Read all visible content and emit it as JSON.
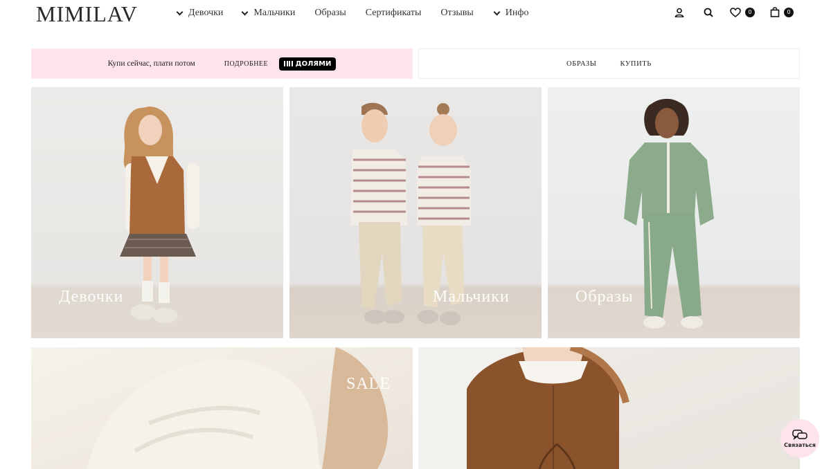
{
  "header": {
    "logo": "MIMILAV",
    "nav": [
      {
        "label": "Девочки",
        "dropdown": true
      },
      {
        "label": "Мальчики",
        "dropdown": true
      },
      {
        "label": "Образы",
        "dropdown": false
      },
      {
        "label": "Сертификаты",
        "dropdown": false
      },
      {
        "label": "Отзывы",
        "dropdown": false
      },
      {
        "label": "Инфо",
        "dropdown": true
      }
    ],
    "icons": {
      "account": "user-icon",
      "search": "search-icon",
      "wishlist": "heart-icon",
      "wishlist_count": "0",
      "cart": "bag-icon",
      "cart_count": "0"
    }
  },
  "promo_left": {
    "text": "Купи сейчас, плати потом",
    "more": "ПОДРОБНЕЕ",
    "badge": "ДОЛЯМИ",
    "bg": "#fde4ea"
  },
  "promo_right": {
    "links": [
      "ОБРАЗЫ",
      "КУПИТЬ"
    ]
  },
  "tiles": [
    {
      "label": "Девочки"
    },
    {
      "label": "Мальчики"
    },
    {
      "label": "Образы"
    },
    {
      "label": "SALE"
    },
    {
      "label": ""
    }
  ],
  "chat": {
    "label": "Связаться",
    "icon": "chat-icon"
  },
  "colors": {
    "accent": "#fde4ea",
    "text": "#222222",
    "badge": "#111111"
  }
}
